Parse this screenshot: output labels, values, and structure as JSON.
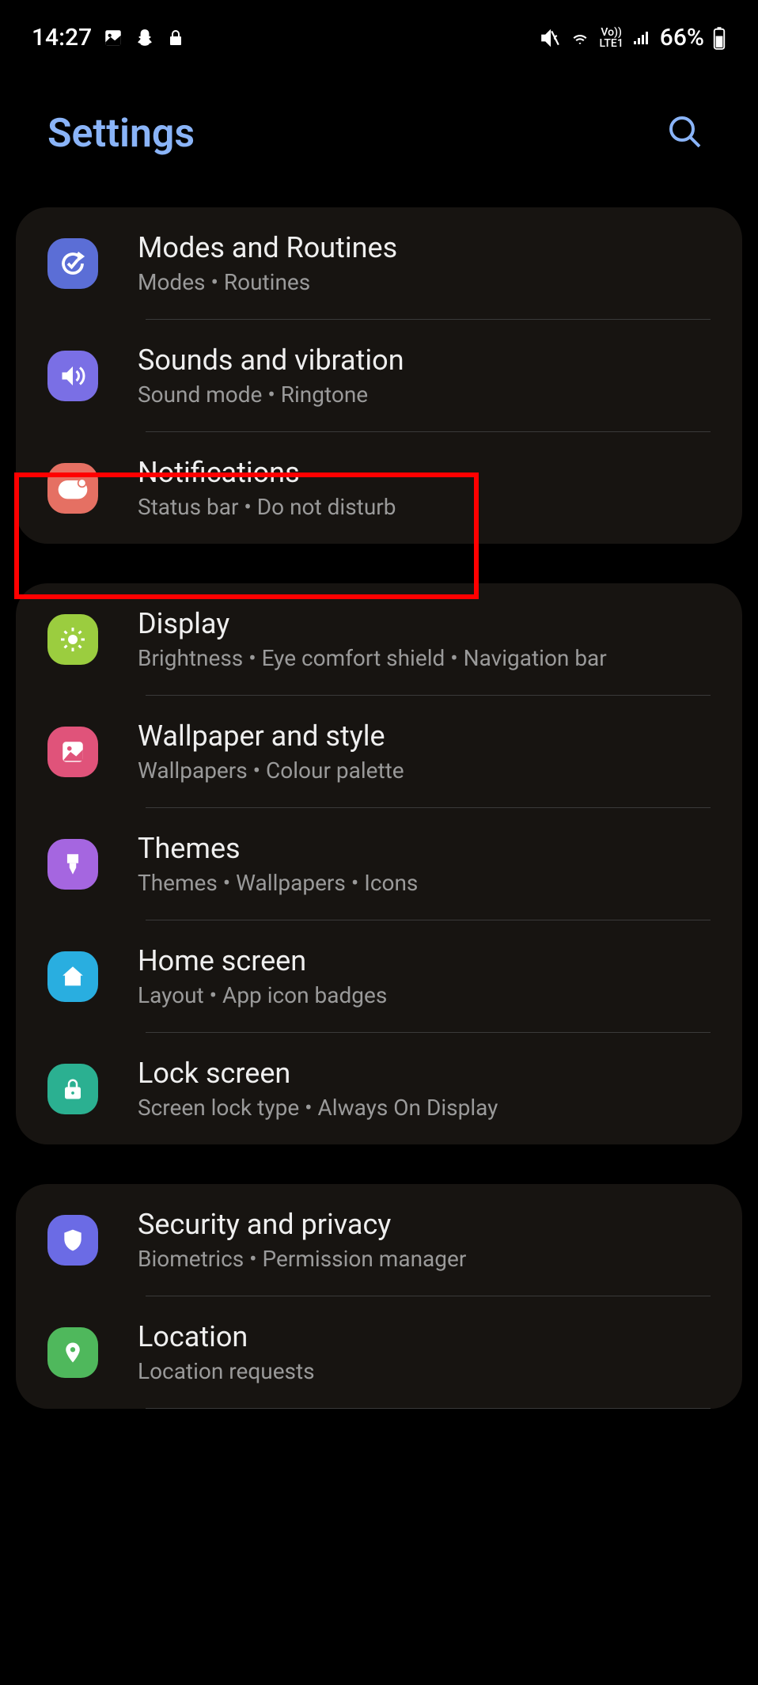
{
  "status": {
    "time": "14:27",
    "battery": "66%"
  },
  "header": {
    "title": "Settings"
  },
  "groups": [
    {
      "items": [
        {
          "id": "modes",
          "title": "Modes and Routines",
          "sub": "Modes  •  Routines",
          "icon": "modes-icon",
          "bg": "bg-blue"
        },
        {
          "id": "sounds",
          "title": "Sounds and vibration",
          "sub": "Sound mode  •  Ringtone",
          "icon": "volume-icon",
          "bg": "bg-purple"
        },
        {
          "id": "notifications",
          "title": "Notifications",
          "sub": "Status bar  •  Do not disturb",
          "icon": "notification-icon",
          "bg": "bg-coral",
          "highlighted": true
        }
      ]
    },
    {
      "items": [
        {
          "id": "display",
          "title": "Display",
          "sub": "Brightness  •  Eye comfort shield  •  Navigation bar",
          "icon": "sun-icon",
          "bg": "bg-lime"
        },
        {
          "id": "wallpaper",
          "title": "Wallpaper and style",
          "sub": "Wallpapers  •  Colour palette",
          "icon": "image-icon",
          "bg": "bg-pink"
        },
        {
          "id": "themes",
          "title": "Themes",
          "sub": "Themes  •  Wallpapers  •  Icons",
          "icon": "brush-icon",
          "bg": "bg-violet"
        },
        {
          "id": "home",
          "title": "Home screen",
          "sub": "Layout  •  App icon badges",
          "icon": "home-icon",
          "bg": "bg-cyan"
        },
        {
          "id": "lock",
          "title": "Lock screen",
          "sub": "Screen lock type  •  Always On Display",
          "icon": "lock-icon",
          "bg": "bg-teal"
        }
      ]
    },
    {
      "items": [
        {
          "id": "security",
          "title": "Security and privacy",
          "sub": "Biometrics  •  Permission manager",
          "icon": "shield-icon",
          "bg": "bg-indigo"
        },
        {
          "id": "location",
          "title": "Location",
          "sub": "Location requests",
          "icon": "pin-icon",
          "bg": "bg-green"
        }
      ]
    }
  ]
}
